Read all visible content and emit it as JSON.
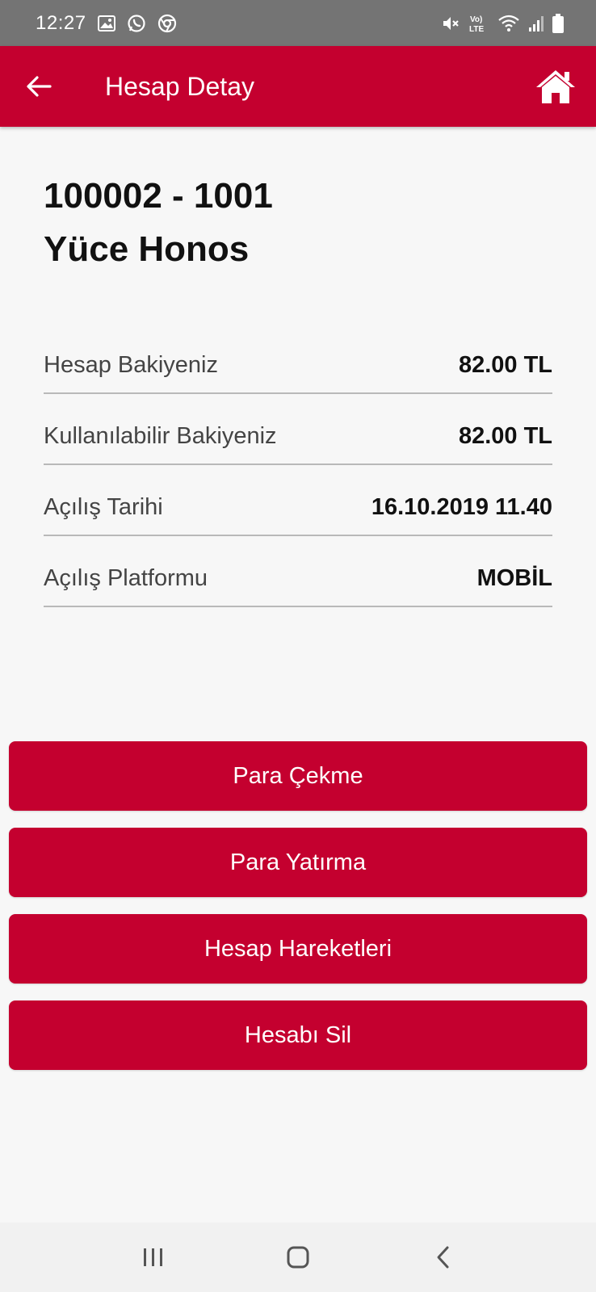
{
  "status_bar": {
    "time": "12:27",
    "left_icons": [
      "image-icon",
      "whatsapp-icon",
      "chrome-icon"
    ],
    "right_icons": [
      "mute-icon",
      "volte-icon",
      "wifi-icon",
      "signal-icon",
      "battery-icon"
    ],
    "volte_label": "Vo) LTE"
  },
  "app_bar": {
    "title": "Hesap Detay",
    "color": "#c4002f"
  },
  "account": {
    "number": "100002 - 1001",
    "owner": "Yüce Honos"
  },
  "details": [
    {
      "label": "Hesap Bakiyeniz",
      "value": "82.00 TL"
    },
    {
      "label": "Kullanılabilir Bakiyeniz",
      "value": "82.00 TL"
    },
    {
      "label": "Açılış Tarihi",
      "value": "16.10.2019 11.40"
    },
    {
      "label": "Açılış Platformu",
      "value": "MOBİL"
    }
  ],
  "actions": [
    {
      "label": "Para Çekme"
    },
    {
      "label": "Para Yatırma"
    },
    {
      "label": "Hesap Hareketleri"
    },
    {
      "label": "Hesabı Sil"
    }
  ],
  "nav_bar": {
    "buttons": [
      "recent-apps-icon",
      "home-nav-icon",
      "back-nav-icon"
    ]
  }
}
